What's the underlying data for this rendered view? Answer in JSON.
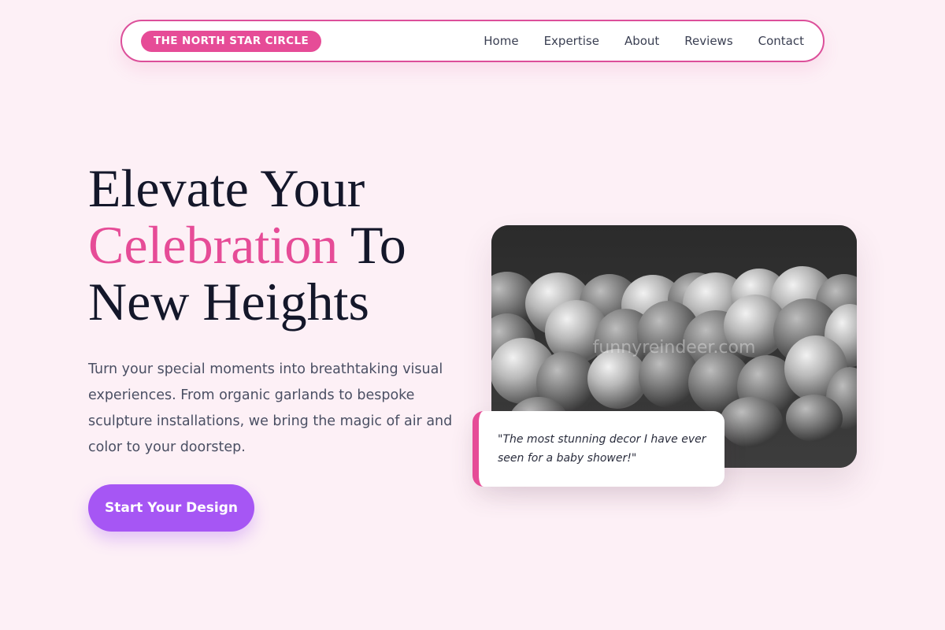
{
  "nav": {
    "brand": "THE NORTH STAR CIRCLE",
    "links": [
      "Home",
      "Expertise",
      "About",
      "Reviews",
      "Contact"
    ]
  },
  "hero": {
    "title_line1": "Elevate Your",
    "title_accent": "Celebration",
    "title_line2_rest": " To",
    "title_line3": "New Heights",
    "description": "Turn your special moments into breathtaking visual experiences. From organic garlands to bespoke sculpture installations, we bring the magic of air and color to your doorstep.",
    "cta_label": "Start Your Design"
  },
  "image": {
    "watermark": "funnyreindeer.com"
  },
  "testimonial": {
    "quote": "\"The most stunning decor I have ever seen for a baby shower!\""
  },
  "colors": {
    "background": "#fdf0f6",
    "accent_pink": "#e64c97",
    "cta_purple": "#a656f4",
    "heading": "#14172a"
  }
}
